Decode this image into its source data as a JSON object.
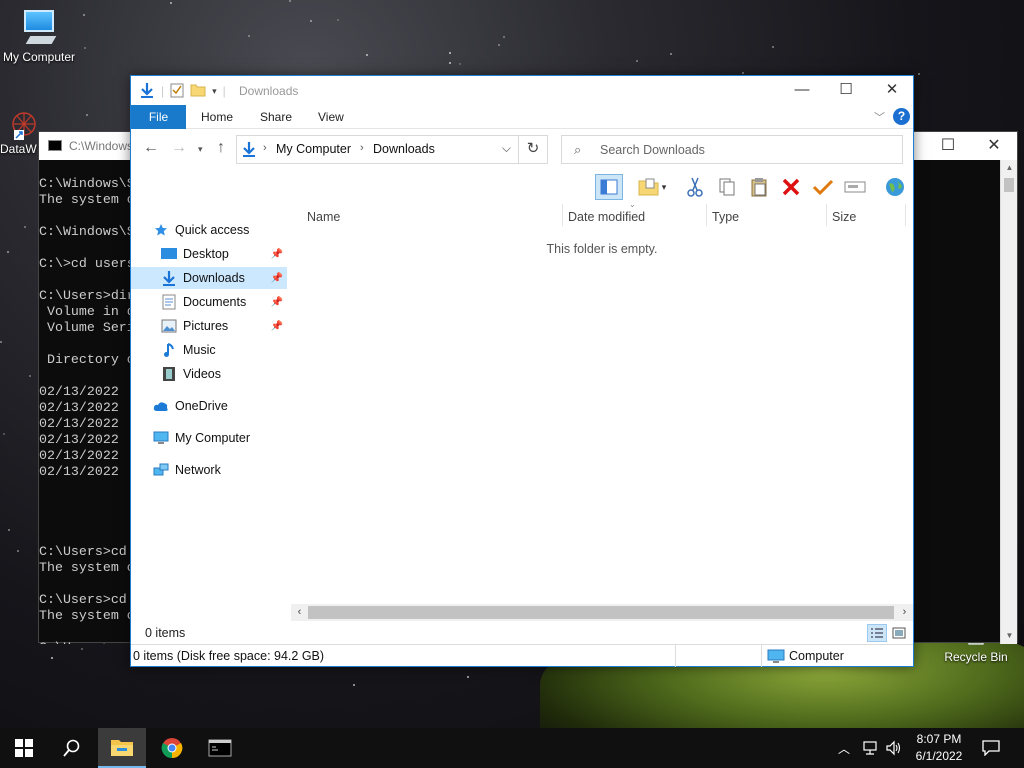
{
  "desktop": {
    "icons": [
      {
        "label": "My Computer"
      },
      {
        "label": "DataW"
      },
      {
        "label": "Recycle Bin"
      }
    ]
  },
  "console": {
    "title": "C:\\Windows",
    "lines": [
      "C:\\Windows\\S",
      "The system c",
      "",
      "C:\\Windows\\S",
      "",
      "C:\\>cd users",
      "",
      "C:\\Users>dir",
      " Volume in d",
      " Volume Seri",
      "",
      " Directory o",
      "",
      "02/13/2022",
      "02/13/2022",
      "02/13/2022",
      "02/13/2022",
      "02/13/2022",
      "02/13/2022",
      "",
      "",
      "",
      "",
      "C:\\Users>cd",
      "The system c",
      "",
      "C:\\Users>cd",
      "The system c",
      "",
      "C:\\Users>"
    ]
  },
  "explorer": {
    "title": "Downloads",
    "ribbon_tabs": [
      "File",
      "Home",
      "Share",
      "View"
    ],
    "breadcrumb": [
      "My Computer",
      "Downloads"
    ],
    "search_placeholder": "Search Downloads",
    "nav": {
      "quick_access": "Quick access",
      "items": [
        {
          "label": "Desktop",
          "pinned": true
        },
        {
          "label": "Downloads",
          "pinned": true,
          "selected": true
        },
        {
          "label": "Documents",
          "pinned": true
        },
        {
          "label": "Pictures",
          "pinned": true
        },
        {
          "label": "Music",
          "pinned": false
        },
        {
          "label": "Videos",
          "pinned": false
        }
      ],
      "onedrive": "OneDrive",
      "my_computer": "My Computer",
      "network": "Network"
    },
    "columns": [
      "Name",
      "Date modified",
      "Type",
      "Size"
    ],
    "empty_message": "This folder is empty.",
    "item_count": "0 items",
    "details": "0 items (Disk free space: 94.2 GB)",
    "zone": "Computer"
  },
  "taskbar": {
    "time": "8:07 PM",
    "date": "6/1/2022"
  },
  "colors": {
    "accent": "#1979ca",
    "selection": "#cce8ff",
    "taskbar": "#101010"
  }
}
